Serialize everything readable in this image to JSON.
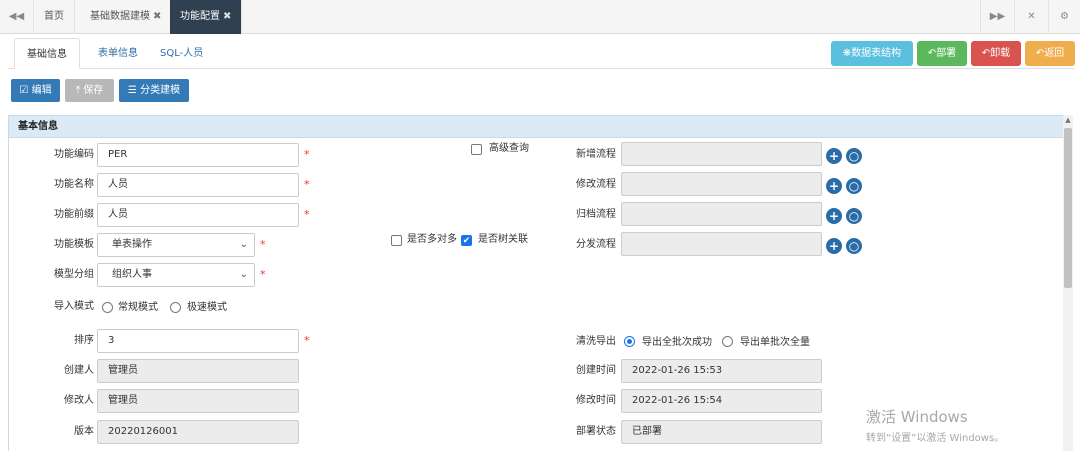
{
  "topbar": {
    "nav_prev_icon": "double-left-icon",
    "tabs": [
      {
        "label": "首页"
      },
      {
        "label": "基础数据建模"
      },
      {
        "label": "功能配置"
      }
    ],
    "close_glyph": "✖",
    "right_icons": [
      "double-right-icon",
      "fullscreen-icon",
      "gear-icon"
    ]
  },
  "subtabs": [
    "基础信息",
    "表单信息",
    "SQL-人员"
  ],
  "header_buttons": {
    "table_struct": "数据表结构",
    "deploy": "部署",
    "uninstall": "卸载",
    "back": "返回"
  },
  "action_buttons": {
    "edit": "编辑",
    "save": "保存",
    "classify": "分类建模"
  },
  "section": {
    "title": "基本信息"
  },
  "form": {
    "code_label": "功能编码",
    "code_value": "PER",
    "name_label": "功能名称",
    "name_value": "人员",
    "prefix_label": "功能前缀",
    "prefix_value": "人员",
    "template_label": "功能模板",
    "template_value": "单表操作",
    "group_label": "模型分组",
    "group_value": "组织人事",
    "import_label": "导入模式",
    "import_opt1": "常规模式",
    "import_opt2": "极速模式",
    "sort_label": "排序",
    "sort_value": "3",
    "creator_label": "创建人",
    "creator_value": "管理员",
    "modifier_label": "修改人",
    "modifier_value": "管理员",
    "version_label": "版本",
    "version_value": "20220126001",
    "adv_query_label": "高级查询",
    "many_to_many_label": "是否多对多",
    "tree_label": "是否树关联",
    "flow_add_label": "新增流程",
    "flow_edit_label": "修改流程",
    "flow_archive_label": "归档流程",
    "flow_dispatch_label": "分发流程",
    "clean_export_label": "清洗导出",
    "clean_opt1": "导出全批次成功",
    "clean_opt2": "导出单批次全量",
    "created_time_label": "创建时间",
    "created_time_value": "2022-01-26 15:53",
    "modified_time_label": "修改时间",
    "modified_time_value": "2022-01-26 15:54",
    "deploy_status_label": "部署状态",
    "deploy_status_value": "已部署"
  },
  "watermark": {
    "line1": "激活 Windows",
    "line2": "转到“设置”以激活 Windows。"
  },
  "colors": {
    "active_tab": "#2f4050",
    "table_struct_btn": "#5bc0de",
    "deploy_btn": "#5cb85c",
    "uninstall_btn": "#d9534f",
    "back_btn": "#f0ad4e",
    "primary_btn": "#337ab7",
    "disabled_btn": "#b8b8b8"
  }
}
